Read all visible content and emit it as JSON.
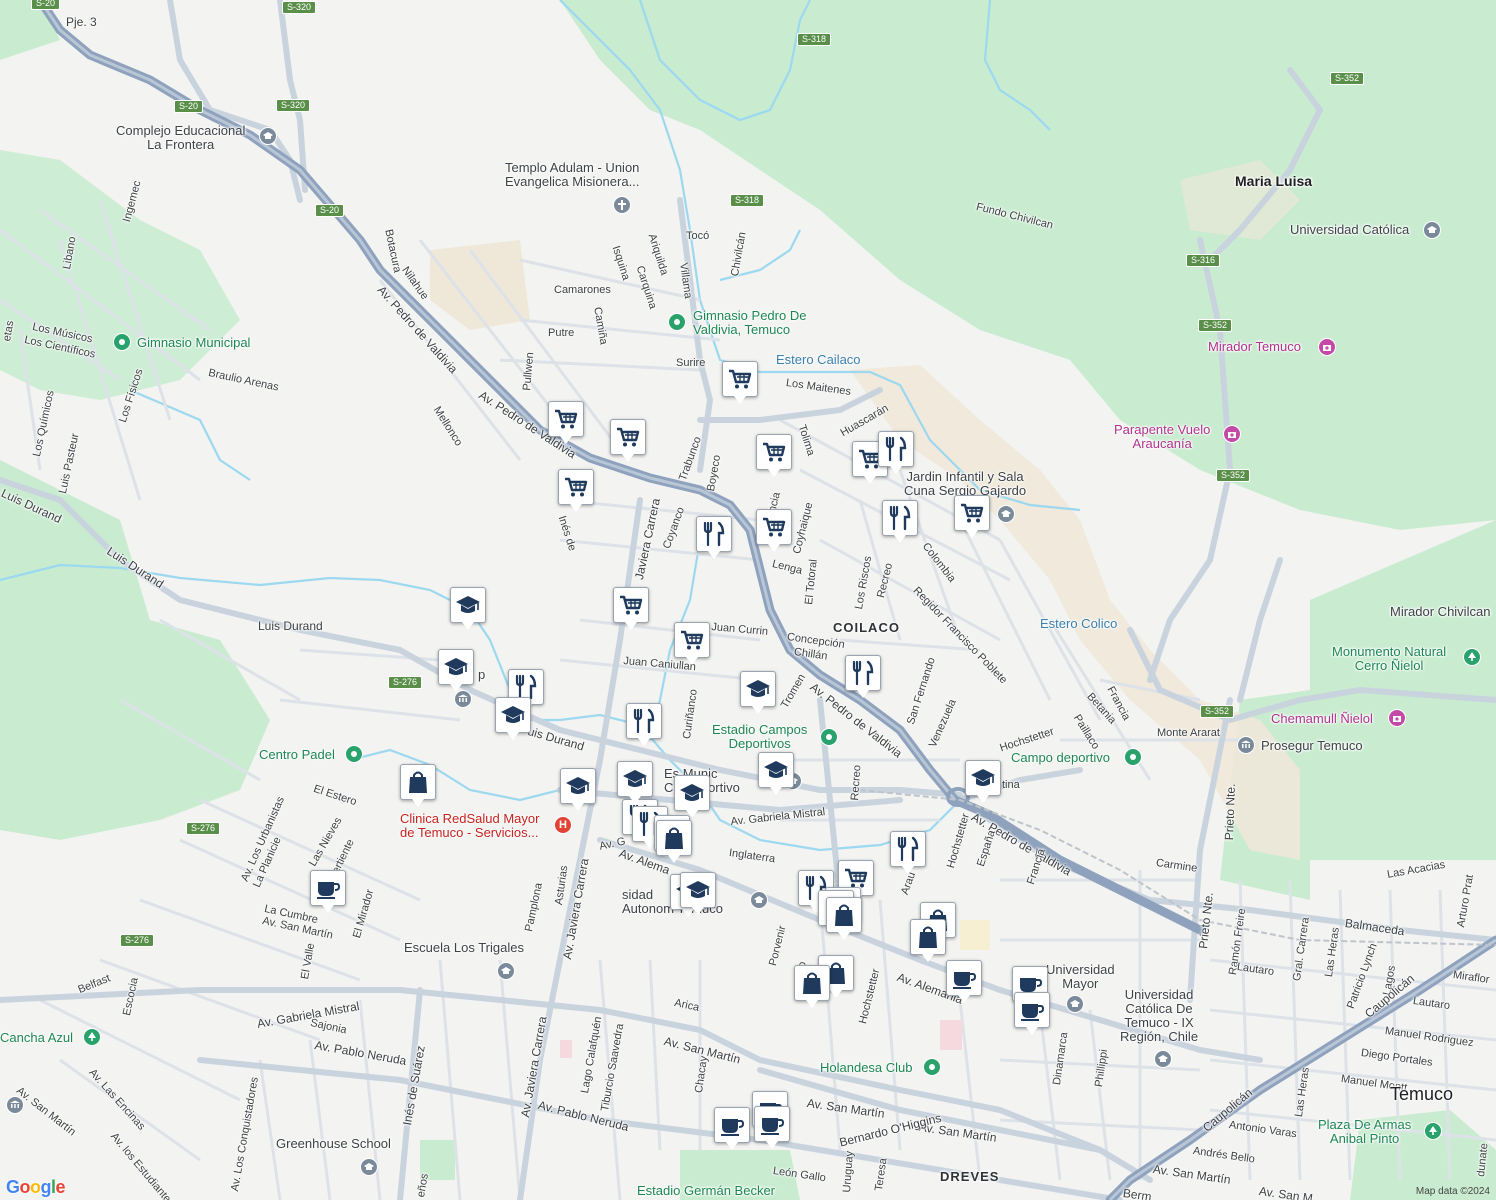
{
  "map": {
    "attribution": "Map data ©2024",
    "logo_letters": [
      {
        "ch": "G",
        "color": "#4285f4"
      },
      {
        "ch": "o",
        "color": "#ea4335"
      },
      {
        "ch": "o",
        "color": "#fbbc05"
      },
      {
        "ch": "g",
        "color": "#4285f4"
      },
      {
        "ch": "l",
        "color": "#34a853"
      },
      {
        "ch": "e",
        "color": "#ea4335"
      }
    ],
    "colors": {
      "land": "#f3f3f1",
      "park": "#c9ecd0",
      "sand": "#f1ead9",
      "water": "#9cd8ef",
      "highway": "#8ea2bd",
      "major": "#c9d3de",
      "minor": "#dfe3e8",
      "marker_icon": "#1f3a5c"
    }
  },
  "road_labels": [
    {
      "id": "pje3",
      "text": "Pje. 3"
    },
    {
      "id": "pdv1",
      "text": "Av. Pedro de Valdivia"
    },
    {
      "id": "pdv2",
      "text": "Av. Pedro de Valdivia"
    },
    {
      "id": "pdv3",
      "text": "Av. Pedro de Valdivia"
    },
    {
      "id": "pdv4",
      "text": "Av. Pedro de Valdivia"
    },
    {
      "id": "botacura",
      "text": "Botacura"
    },
    {
      "id": "nilahue",
      "text": "Nilahue"
    },
    {
      "id": "libano",
      "text": "Libano"
    },
    {
      "id": "ingemec",
      "text": "Ingemec"
    },
    {
      "id": "musicos",
      "text": "Los Músicos"
    },
    {
      "id": "cientificos",
      "text": "Los Científicos"
    },
    {
      "id": "braulio",
      "text": "Braulio Arenas"
    },
    {
      "id": "quimicos",
      "text": "Los Químicos"
    },
    {
      "id": "fisicos",
      "text": "Los Físicos"
    },
    {
      "id": "pasteur",
      "text": "Luis Pasteur"
    },
    {
      "id": "melloncp",
      "text": "Mellonco"
    },
    {
      "id": "durand1",
      "text": "Luis Durand"
    },
    {
      "id": "durand2",
      "text": "Luis Durand"
    },
    {
      "id": "durand3",
      "text": "Luis Durand"
    },
    {
      "id": "durand4",
      "text": "uis Durand"
    },
    {
      "id": "camarones",
      "text": "Camarones"
    },
    {
      "id": "putre",
      "text": "Putre"
    },
    {
      "id": "canina",
      "text": "Camiña"
    },
    {
      "id": "pullwen",
      "text": "Pullwen"
    },
    {
      "id": "isquina",
      "text": "Isquina"
    },
    {
      "id": "ariquilda",
      "text": "Ariquilda"
    },
    {
      "id": "carquina",
      "text": "Carquina"
    },
    {
      "id": "villama",
      "text": "Villama"
    },
    {
      "id": "toco",
      "text": "Tocó"
    },
    {
      "id": "chivilcan",
      "text": "Chivilcán"
    },
    {
      "id": "surire",
      "text": "Surire"
    },
    {
      "id": "maitenes",
      "text": "Los Maitenes"
    },
    {
      "id": "trabunco",
      "text": "Trabunco"
    },
    {
      "id": "boyeco",
      "text": "Boyeco"
    },
    {
      "id": "coyanco",
      "text": "Coyanco"
    },
    {
      "id": "ines",
      "text": "Inés de"
    },
    {
      "id": "javiera1",
      "text": "Javiera Carrera"
    },
    {
      "id": "javiera2",
      "text": "Av. Javiera Carrera"
    },
    {
      "id": "javiera3",
      "text": "Av. Javiera Carrera"
    },
    {
      "id": "independ",
      "text": "pendencia"
    },
    {
      "id": "coyhaique",
      "text": "Coyhaique"
    },
    {
      "id": "tolima",
      "text": "Tolima"
    },
    {
      "id": "huascaran",
      "text": "Huascarán"
    },
    {
      "id": "lenga",
      "text": "Lenga"
    },
    {
      "id": "totoral",
      "text": "El Totoral"
    },
    {
      "id": "riscos",
      "text": "Los Riscos"
    },
    {
      "id": "recreo1",
      "text": "Recreo"
    },
    {
      "id": "recreo2",
      "text": "Recreo"
    },
    {
      "id": "recreo3",
      "text": "ecreo"
    },
    {
      "id": "colombia",
      "text": "Colombia"
    },
    {
      "id": "regidor",
      "text": "Regidor Francisco Poblete"
    },
    {
      "id": "currin",
      "text": "Juan Currin"
    },
    {
      "id": "caniullan",
      "text": "Juan Caniullan"
    },
    {
      "id": "concepcion",
      "text": "Concepción"
    },
    {
      "id": "chillan",
      "text": "Chillán"
    },
    {
      "id": "tromen",
      "text": "Tromen"
    },
    {
      "id": "curinanco",
      "text": "Curiñanco"
    },
    {
      "id": "sanfernando",
      "text": "San Fernando"
    },
    {
      "id": "venezuela",
      "text": "Venezuela"
    },
    {
      "id": "hochstetter1",
      "text": "Hochstetter"
    },
    {
      "id": "hochstetter2",
      "text": "Hochstetter"
    },
    {
      "id": "hochstetter3",
      "text": "Hochstetter"
    },
    {
      "id": "francia1",
      "text": "Francia"
    },
    {
      "id": "francia2",
      "text": "Francia"
    },
    {
      "id": "betania",
      "text": "Betania"
    },
    {
      "id": "pailaco",
      "text": "Paillaco"
    },
    {
      "id": "montearar",
      "text": "Monte Ararat"
    },
    {
      "id": "argentina",
      "text": "tina"
    },
    {
      "id": "gmistral1",
      "text": "Av. Gabriela Mistral"
    },
    {
      "id": "gmistral2",
      "text": "Av. Gabriela Mistral"
    },
    {
      "id": "avgu",
      "text": "Av. G"
    },
    {
      "id": "inglaterra",
      "text": "Inglaterra"
    },
    {
      "id": "alemania1",
      "text": "Av. Alema"
    },
    {
      "id": "alemania2",
      "text": "Av. Alemania"
    },
    {
      "id": "espana",
      "text": "España"
    },
    {
      "id": "arauco",
      "text": "Arau"
    },
    {
      "id": "carmine",
      "text": "Carmine"
    },
    {
      "id": "acacias",
      "text": "Las Acacias"
    },
    {
      "id": "prieto1",
      "text": "Prieto Nte."
    },
    {
      "id": "prieto2",
      "text": "Prieto Nte."
    },
    {
      "id": "balmaceda",
      "text": "Balmaceda"
    },
    {
      "id": "ramonfreire",
      "text": "Ramón Freire"
    },
    {
      "id": "lautaro1",
      "text": "Lautaro"
    },
    {
      "id": "lautaro2",
      "text": "Lautaro"
    },
    {
      "id": "grlcarrera",
      "text": "Gral. Carrera"
    },
    {
      "id": "lasheras1",
      "text": "Las Heras"
    },
    {
      "id": "lasheras2",
      "text": "Las Heras"
    },
    {
      "id": "patricio",
      "text": "Patricio Lynch"
    },
    {
      "id": "lagos",
      "text": "Lagos"
    },
    {
      "id": "arturoprat",
      "text": "Arturo Prat"
    },
    {
      "id": "miraflores",
      "text": "Miraflor"
    },
    {
      "id": "caupolican1",
      "text": "Caupolicán"
    },
    {
      "id": "caupolican2",
      "text": "Caupolicán"
    },
    {
      "id": "manuelrod",
      "text": "Manuel Rodriguez"
    },
    {
      "id": "diegoport",
      "text": "Diego Portales"
    },
    {
      "id": "manuelmontt",
      "text": "Manuel Montt"
    },
    {
      "id": "antoniovaras",
      "text": "Antonio Varas"
    },
    {
      "id": "andresbello",
      "text": "Andrés Bello"
    },
    {
      "id": "sanmartin1",
      "text": "Av. San Martín"
    },
    {
      "id": "sanmartin2",
      "text": "Av. San Martín"
    },
    {
      "id": "sanmartin3",
      "text": "Av. San Martín"
    },
    {
      "id": "sanmartin4",
      "text": "Av. San Martín"
    },
    {
      "id": "sanmartin5",
      "text": "Av. San M"
    },
    {
      "id": "sanmartin6",
      "text": "Av. San Martín"
    },
    {
      "id": "pneruda1",
      "text": "Av. Pablo Neruda"
    },
    {
      "id": "pneruda2",
      "text": "Av. Pablo Neruda"
    },
    {
      "id": "ohiggins",
      "text": "Bernardo O'Higgins"
    },
    {
      "id": "leongallo",
      "text": "León Gallo"
    },
    {
      "id": "uruguay",
      "text": "Uruguay"
    },
    {
      "id": "teresa",
      "text": "Teresa"
    },
    {
      "id": "dinamarca",
      "text": "Dinamarca"
    },
    {
      "id": "phillippi",
      "text": "Phillippi"
    },
    {
      "id": "dunate",
      "text": "dunate"
    },
    {
      "id": "porvenir",
      "text": "Porvenir"
    },
    {
      "id": "arica",
      "text": "Arica"
    },
    {
      "id": "chacay",
      "text": "Chacay"
    },
    {
      "id": "calafquen",
      "text": "Lago Calafquén"
    },
    {
      "id": "saavedra",
      "text": "Tiburcio Saavedra"
    },
    {
      "id": "pamplona",
      "text": "Pamplona"
    },
    {
      "id": "asturias",
      "text": "Asturias"
    },
    {
      "id": "inessuarez",
      "text": "Inés de Suárez"
    },
    {
      "id": "sajonia",
      "text": "Sajonia"
    },
    {
      "id": "belfast",
      "text": "Belfast"
    },
    {
      "id": "escocia",
      "text": "Escocia"
    },
    {
      "id": "elvalle",
      "text": "El Valle"
    },
    {
      "id": "lacumbre",
      "text": "La Cumbre"
    },
    {
      "id": "avsanmartin",
      "text": "Av. San Martín"
    },
    {
      "id": "elmirador",
      "text": "El Mirador"
    },
    {
      "id": "elestero",
      "text": "El Estero"
    },
    {
      "id": "laplanicie",
      "text": "La Planicie"
    },
    {
      "id": "urbanistas",
      "text": "Av. Los Urbanistas"
    },
    {
      "id": "lasnieves",
      "text": "Las Nieves"
    },
    {
      "id": "vertiente",
      "text": "Vertiente"
    },
    {
      "id": "encinas",
      "text": "Av. Las Encinas"
    },
    {
      "id": "conquistadores",
      "text": "Av. Los Conquistadores"
    },
    {
      "id": "estudiantes",
      "text": "Av. los Estudiantes"
    },
    {
      "id": "fundochivilcan",
      "text": "Fundo Chivilcan"
    },
    {
      "id": "aenos",
      "text": "eños"
    },
    {
      "id": "fetas",
      "text": "etas"
    },
    {
      "id": "berm",
      "text": "Berm"
    }
  ],
  "place_labels": [
    {
      "id": "marialuisa",
      "text": "Maria Luisa",
      "kind": "town"
    },
    {
      "id": "coilaco",
      "text": "COILACO",
      "kind": "hood"
    },
    {
      "id": "dreves",
      "text": "DREVES",
      "kind": "hood"
    },
    {
      "id": "temuco",
      "text": "Temuco",
      "kind": "city"
    },
    {
      "id": "esterocailaco",
      "text": "Estero Cailaco",
      "kind": "water"
    },
    {
      "id": "esterocolico",
      "text": "Estero Colico",
      "kind": "water"
    }
  ],
  "pois": [
    {
      "id": "complejo",
      "line1": "Complejo Educacional",
      "line2": "La Frontera",
      "style": "grey",
      "icon": "school-icon"
    },
    {
      "id": "templo",
      "line1": "Templo Adulam - Union",
      "line2": "Evangelica Misionera...",
      "style": "grey",
      "icon": "church-icon"
    },
    {
      "id": "gimnasiopv",
      "line1": "Gimnasio Pedro De",
      "line2": "Valdivia, Temuco",
      "style": "green",
      "icon": "park-icon"
    },
    {
      "id": "gimnasiomun",
      "line1": "Gimnasio Municipal",
      "line2": "",
      "style": "green",
      "icon": "park-icon"
    },
    {
      "id": "ucatolica",
      "line1": "Universidad Católica",
      "line2": "",
      "style": "grey",
      "icon": "school-icon"
    },
    {
      "id": "mirador",
      "line1": "Mirador Temuco",
      "line2": "",
      "style": "pink",
      "icon": "camera-icon"
    },
    {
      "id": "parapente",
      "line1": "Parapente Vuelo",
      "line2": "Araucanía",
      "style": "pink",
      "icon": "camera-icon"
    },
    {
      "id": "jardin",
      "line1": "Jardin Infantil y Sala",
      "line2": "Cuna Sergio Gajardo",
      "style": "grey",
      "icon": "school-icon"
    },
    {
      "id": "chivilcan",
      "line1": "Mirador Chivilcan",
      "line2": "",
      "style": "grey",
      "icon": ""
    },
    {
      "id": "nielol",
      "line1": "Monumento Natural",
      "line2": "Cerro Ñielol",
      "style": "green",
      "icon": "tree-icon"
    },
    {
      "id": "chemamull",
      "line1": "Chemamull Ñielol",
      "line2": "",
      "style": "pink",
      "icon": "camera-icon"
    },
    {
      "id": "prosegur",
      "line1": "Prosegur Temuco",
      "line2": "",
      "style": "grey",
      "icon": "bank-icon"
    },
    {
      "id": "campodep",
      "line1": "Campo deportivo",
      "line2": "",
      "style": "green",
      "icon": "park-icon"
    },
    {
      "id": "estadiocampos",
      "line1": "Estadio Campos",
      "line2": "Deportivos",
      "style": "green",
      "icon": "park-icon"
    },
    {
      "id": "escuelamun",
      "line1": "Es      Munic",
      "line2": "Ca      Deportivo",
      "style": "grey",
      "icon": "school-icon"
    },
    {
      "id": "centropadel",
      "line1": "Centro Padel",
      "line2": "",
      "style": "green",
      "icon": "park-icon"
    },
    {
      "id": "clinica",
      "line1": "Clinica RedSalud Mayor",
      "line2": "de Temuco - Servicios...",
      "style": "red",
      "icon": "hospital-icon"
    },
    {
      "id": "uautonoma",
      "line1": "      sidad",
      "line2": "Autonom   Temuco",
      "style": "grey",
      "icon": "school-icon"
    },
    {
      "id": "triagles",
      "line1": "Escuela Los Trigales",
      "line2": "",
      "style": "grey",
      "icon": "school-icon"
    },
    {
      "id": "umayor",
      "line1": "Universidad",
      "line2": "Mayor",
      "style": "grey",
      "icon": "school-icon"
    },
    {
      "id": "ucatix",
      "line1": "Universidad",
      "line2": "Católica De|Temuco - IX|Región, Chile",
      "style": "grey",
      "icon": "school-icon"
    },
    {
      "id": "holandesa",
      "line1": "Holandesa Club",
      "line2": "",
      "style": "green",
      "icon": "park-icon"
    },
    {
      "id": "canchaazul",
      "line1": "Cancha Azul",
      "line2": "",
      "style": "green",
      "icon": "tree-icon"
    },
    {
      "id": "greenhouse",
      "line1": "Greenhouse School",
      "line2": "",
      "style": "grey",
      "icon": "school-icon"
    },
    {
      "id": "plazaarmas",
      "line1": "Plaza De Armas",
      "line2": "Anibal Pinto",
      "style": "green",
      "icon": "tree-icon"
    },
    {
      "id": "estadiogb",
      "line1": "Estadio Germán Becker",
      "line2": "",
      "style": "green",
      "icon": ""
    },
    {
      "id": "rpk",
      "line1": "p",
      "line2": "",
      "style": "grey",
      "icon": "bank-icon"
    }
  ],
  "road_shields": [
    {
      "id": "s20a",
      "text": "S-20"
    },
    {
      "id": "s320a",
      "text": "S-320"
    },
    {
      "id": "s20b",
      "text": "S-20"
    },
    {
      "id": "s320b",
      "text": "S-320"
    },
    {
      "id": "s20c",
      "text": "S-20"
    },
    {
      "id": "s318a",
      "text": "S-318"
    },
    {
      "id": "s318b",
      "text": "S-318"
    },
    {
      "id": "s352a",
      "text": "S-352"
    },
    {
      "id": "s316",
      "text": "S-316"
    },
    {
      "id": "s352b",
      "text": "S-352"
    },
    {
      "id": "s352c",
      "text": "S-352"
    },
    {
      "id": "s352d",
      "text": "S-352"
    },
    {
      "id": "s276a",
      "text": "S-276"
    },
    {
      "id": "s276b",
      "text": "S-276"
    },
    {
      "id": "s276c",
      "text": "S-276"
    }
  ],
  "markers": [
    {
      "id": "m1",
      "type": "grocery"
    },
    {
      "id": "m2",
      "type": "grocery"
    },
    {
      "id": "m3",
      "type": "grocery"
    },
    {
      "id": "m4",
      "type": "grocery"
    },
    {
      "id": "m5",
      "type": "grocery"
    },
    {
      "id": "m6",
      "type": "grocery"
    },
    {
      "id": "m7",
      "type": "grocery"
    },
    {
      "id": "m8",
      "type": "grocery"
    },
    {
      "id": "m9",
      "type": "grocery"
    },
    {
      "id": "m10",
      "type": "grocery"
    },
    {
      "id": "m11",
      "type": "grocery"
    },
    {
      "id": "m12",
      "type": "restaurant"
    },
    {
      "id": "m13",
      "type": "restaurant"
    },
    {
      "id": "m14",
      "type": "restaurant"
    },
    {
      "id": "m15",
      "type": "restaurant"
    },
    {
      "id": "m16",
      "type": "restaurant"
    },
    {
      "id": "m17",
      "type": "restaurant"
    },
    {
      "id": "m18",
      "type": "restaurant"
    },
    {
      "id": "m19",
      "type": "restaurant"
    },
    {
      "id": "m20",
      "type": "restaurant"
    },
    {
      "id": "m21",
      "type": "restaurant"
    },
    {
      "id": "m22",
      "type": "school"
    },
    {
      "id": "m23",
      "type": "school"
    },
    {
      "id": "m24",
      "type": "school"
    },
    {
      "id": "m25",
      "type": "school"
    },
    {
      "id": "m26",
      "type": "school"
    },
    {
      "id": "m27",
      "type": "school"
    },
    {
      "id": "m28",
      "type": "school"
    },
    {
      "id": "m29",
      "type": "school"
    },
    {
      "id": "m30",
      "type": "school"
    },
    {
      "id": "m31",
      "type": "school"
    },
    {
      "id": "m32",
      "type": "school"
    },
    {
      "id": "m33",
      "type": "shopping"
    },
    {
      "id": "m34",
      "type": "shopping"
    },
    {
      "id": "m35",
      "type": "shopping"
    },
    {
      "id": "m36",
      "type": "shopping"
    },
    {
      "id": "m37",
      "type": "shopping"
    },
    {
      "id": "m38",
      "type": "shopping"
    },
    {
      "id": "m39",
      "type": "shopping"
    },
    {
      "id": "m40",
      "type": "shopping"
    },
    {
      "id": "m41",
      "type": "shopping"
    },
    {
      "id": "m42",
      "type": "shopping"
    },
    {
      "id": "m43",
      "type": "cafe"
    },
    {
      "id": "m44",
      "type": "cafe"
    },
    {
      "id": "m45",
      "type": "cafe"
    },
    {
      "id": "m46",
      "type": "cafe"
    },
    {
      "id": "m47",
      "type": "cafe"
    },
    {
      "id": "m48",
      "type": "cafe"
    },
    {
      "id": "m49",
      "type": "cafe"
    }
  ]
}
